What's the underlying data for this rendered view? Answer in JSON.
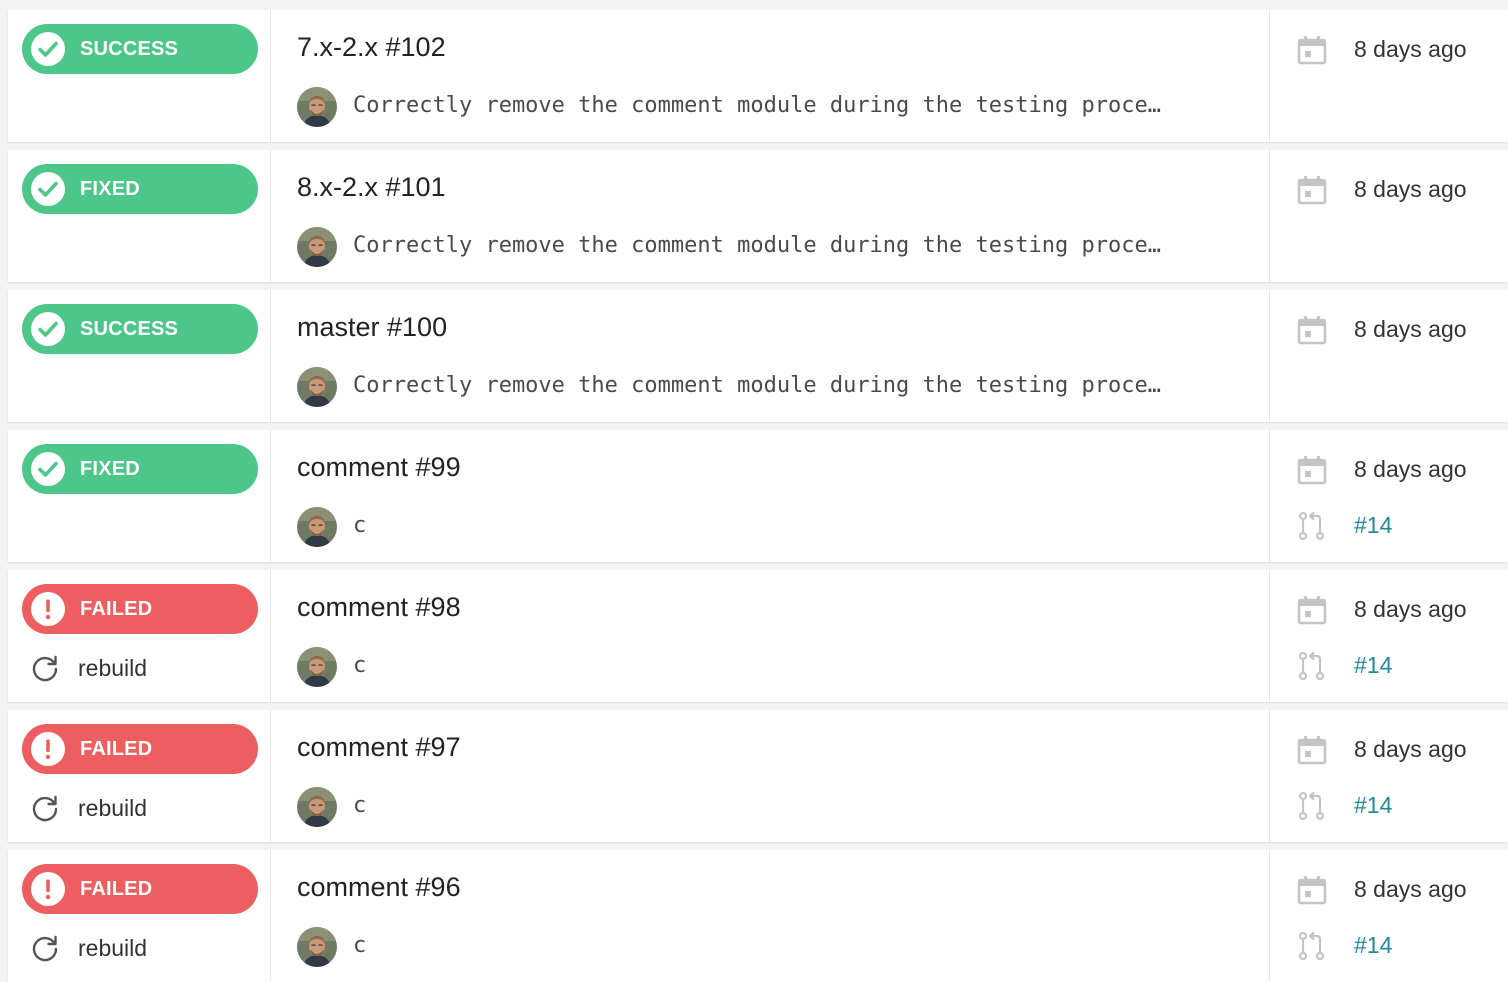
{
  "colors": {
    "success": "#4dc68a",
    "failed": "#ec5e60",
    "link": "#1f8a99",
    "meta_icon": "#c4c4c4"
  },
  "builds": [
    {
      "status": "SUCCESS",
      "kind": "success",
      "title": "7.x-2.x #102",
      "message": "Correctly remove the comment module during the testing proce…",
      "date": "8 days ago",
      "pr": null,
      "rebuild": null
    },
    {
      "status": "FIXED",
      "kind": "success",
      "title": "8.x-2.x #101",
      "message": "Correctly remove the comment module during the testing proce…",
      "date": "8 days ago",
      "pr": null,
      "rebuild": null
    },
    {
      "status": "SUCCESS",
      "kind": "success",
      "title": "master #100",
      "message": "Correctly remove the comment module during the testing proce…",
      "date": "8 days ago",
      "pr": null,
      "rebuild": null
    },
    {
      "status": "FIXED",
      "kind": "success",
      "title": "comment #99",
      "message": "c",
      "date": "8 days ago",
      "pr": "#14",
      "rebuild": null
    },
    {
      "status": "FAILED",
      "kind": "failed",
      "title": "comment #98",
      "message": "c",
      "date": "8 days ago",
      "pr": "#14",
      "rebuild": "rebuild"
    },
    {
      "status": "FAILED",
      "kind": "failed",
      "title": "comment #97",
      "message": "c",
      "date": "8 days ago",
      "pr": "#14",
      "rebuild": "rebuild"
    },
    {
      "status": "FAILED",
      "kind": "failed",
      "title": "comment #96",
      "message": "c",
      "date": "8 days ago",
      "pr": "#14",
      "rebuild": "rebuild"
    }
  ]
}
